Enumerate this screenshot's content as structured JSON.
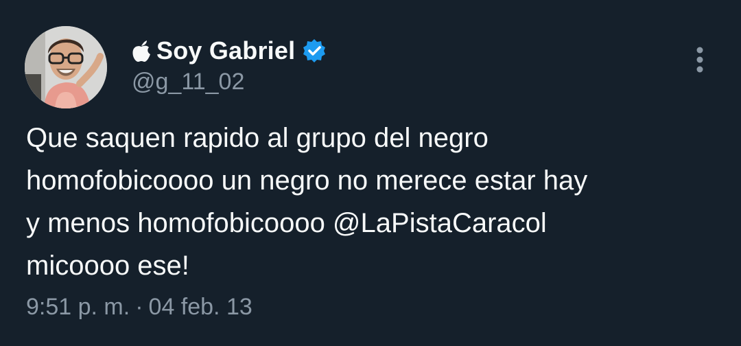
{
  "colors": {
    "background": "#15202b",
    "primary_text": "#f7f9f9",
    "secondary_text": "#8b98a5",
    "verified_badge": "#1d9bf0"
  },
  "author": {
    "avatar_icon": "user-avatar-photo",
    "prefix_icon": "apple-icon",
    "display_name": "Soy Gabriel",
    "badge_icon": "verified-badge-icon",
    "handle": "@g_11_02"
  },
  "menu": {
    "icon": "more-vertical-icon"
  },
  "tweet": {
    "text": "Que saquen rapido al grupo del negro\nhomofobicoooo un negro no merece estar hay\ny menos homofobicoooo @LaPistaCaracol\nmicoooo ese!",
    "time": "9:51 p. m.",
    "separator": "·",
    "date": "04 feb. 13"
  }
}
